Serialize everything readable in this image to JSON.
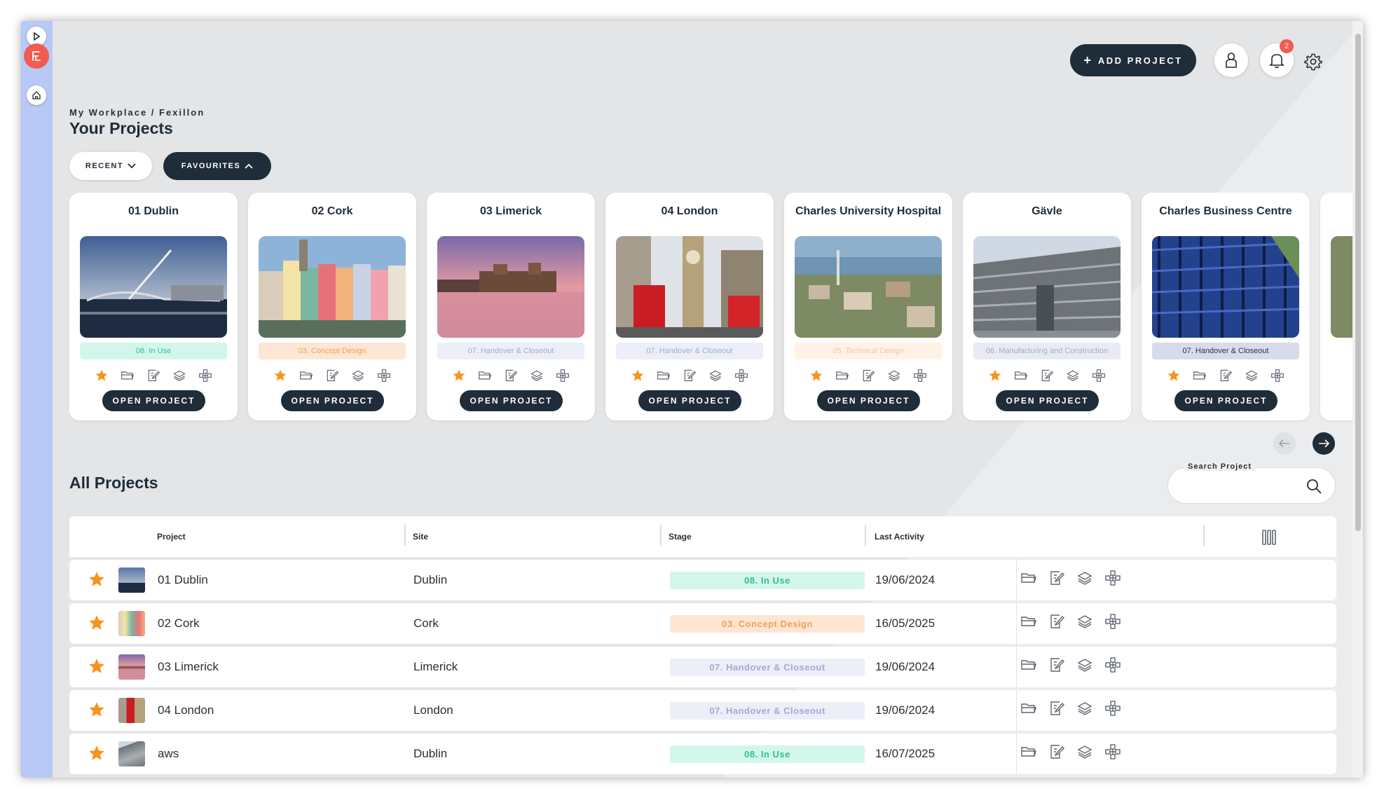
{
  "header": {
    "add_project_label": "ADD PROJECT",
    "notification_count": "2"
  },
  "breadcrumb": "My Workplace / Fexillon",
  "page_title": "Your Projects",
  "filters": {
    "recent_label": "RECENT",
    "favourites_label": "FAVOURITES"
  },
  "cards": [
    {
      "title": "01 Dublin",
      "stage": "08. In Use",
      "open_label": "OPEN PROJECT"
    },
    {
      "title": "02 Cork",
      "stage": "03. Concept Design",
      "open_label": "OPEN PROJECT"
    },
    {
      "title": "03 Limerick",
      "stage": "07. Handover & Closeout",
      "open_label": "OPEN PROJECT"
    },
    {
      "title": "04 London",
      "stage": "07. Handover & Closeout",
      "open_label": "OPEN PROJECT"
    },
    {
      "title": "Charles University Hospital",
      "stage": "05. Technical Design",
      "open_label": "OPEN PROJECT"
    },
    {
      "title": "Gävle",
      "stage": "06. Manufacturing and Construction",
      "open_label": "OPEN PROJECT"
    },
    {
      "title": "Charles Business Centre",
      "stage": "07. Handover & Closeout",
      "open_label": "OPEN PROJECT"
    }
  ],
  "all_projects": {
    "title": "All Projects",
    "search_label": "Search Project",
    "search_value": "",
    "columns": {
      "project": "Project",
      "site": "Site",
      "stage": "Stage",
      "last_activity": "Last Activity"
    },
    "rows": [
      {
        "project": "01 Dublin",
        "site": "Dublin",
        "stage": "08. In Use",
        "last_activity": "19/06/2024"
      },
      {
        "project": "02 Cork",
        "site": "Cork",
        "stage": "03. Concept Design",
        "last_activity": "16/05/2025"
      },
      {
        "project": "03 Limerick",
        "site": "Limerick",
        "stage": "07. Handover & Closeout",
        "last_activity": "19/06/2024"
      },
      {
        "project": "04 London",
        "site": "London",
        "stage": "07. Handover & Closeout",
        "last_activity": "19/06/2024"
      },
      {
        "project": "aws",
        "site": "Dublin",
        "stage": "08. In Use",
        "last_activity": "16/07/2025"
      }
    ]
  },
  "colors": {
    "primary_dark": "#1f2c39",
    "accent_red": "#f15b50",
    "star_orange": "#f7931e",
    "sidebar": "#b8c9f6"
  }
}
